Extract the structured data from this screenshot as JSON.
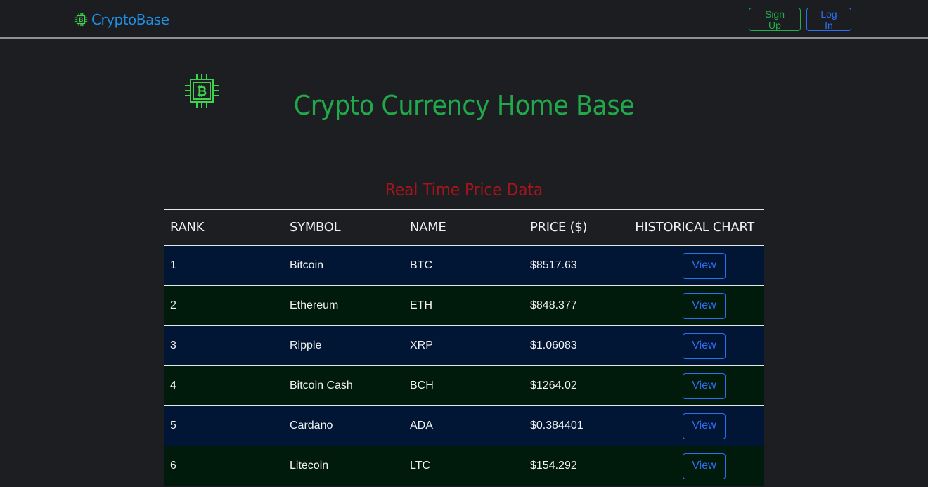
{
  "navbar": {
    "brand_text": "CryptoBase",
    "brand_icon": "bitcoin-chip-icon",
    "signup_label": "Sign Up",
    "login_label": "Log In"
  },
  "hero": {
    "icon": "bitcoin-chip-icon",
    "title": "Crypto Currency Home Base"
  },
  "section": {
    "title": "Real Time Price Data"
  },
  "table": {
    "headers": [
      "RANK",
      "SYMBOL",
      "NAME",
      "PRICE ($)",
      "HISTORICAL CHART"
    ],
    "rows": [
      {
        "rank": "1",
        "col2": "Bitcoin",
        "col3": "BTC",
        "price": "$8517.63",
        "action": "View"
      },
      {
        "rank": "2",
        "col2": "Ethereum",
        "col3": "ETH",
        "price": "$848.377",
        "action": "View"
      },
      {
        "rank": "3",
        "col2": "Ripple",
        "col3": "XRP",
        "price": "$1.06083",
        "action": "View"
      },
      {
        "rank": "4",
        "col2": "Bitcoin Cash",
        "col3": "BCH",
        "price": "$1264.02",
        "action": "View"
      },
      {
        "rank": "5",
        "col2": "Cardano",
        "col3": "ADA",
        "price": "$0.384401",
        "action": "View"
      },
      {
        "rank": "6",
        "col2": "Litecoin",
        "col3": "LTC",
        "price": "$154.292",
        "action": "View"
      }
    ]
  },
  "colors": {
    "brand_blue": "#1f8fe3",
    "accent_green": "#20a84a",
    "accent_red": "#a8141b",
    "button_blue": "#2d6ff2",
    "row_navy": "#001634",
    "row_green": "#001a0c",
    "background": "#1c1e21"
  }
}
